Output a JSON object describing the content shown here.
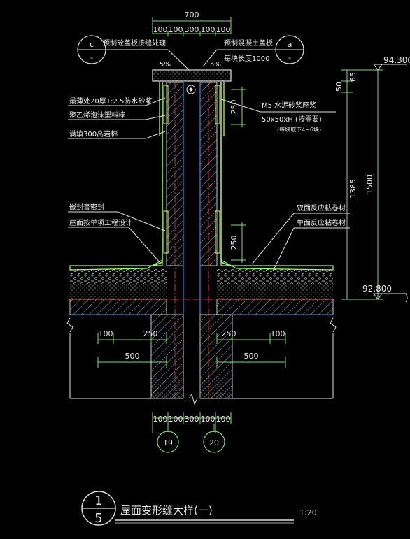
{
  "top_dims": {
    "overall": "700",
    "sub": [
      "100",
      "100",
      "300",
      "100",
      "100"
    ]
  },
  "bottom_dims": {
    "sub": [
      "100",
      "100",
      "300",
      "100",
      "100"
    ]
  },
  "grid_axes": {
    "left": "19",
    "right": "20"
  },
  "callout_left": {
    "letter": "c",
    "dash": "-"
  },
  "callout_right": {
    "letter": "a",
    "dash": "-"
  },
  "top_notes": {
    "left": "预制砼盖板接缝处理",
    "right_1": "预制混凝土盖板",
    "right_2": "每块长度1000"
  },
  "slopes": {
    "left": "5%",
    "right": "5%"
  },
  "left_labels": [
    "最薄处20厚1:2.5防水砂浆",
    "聚乙烯泡沫塑料棒",
    "满填300高岩棉",
    "嵌封膏密封",
    "屋面按单项工程设计"
  ],
  "right_labels": {
    "mortar": "M5 水泥砂浆座浆",
    "block": "50x50xH (按需要)",
    "block_note": "(每块取下4~6块)",
    "mem_double": "双面反应粘卷材",
    "mem_single": "单面反应粘卷材"
  },
  "vertical_dims": {
    "d250_top": "250",
    "d250_bottom": "250",
    "d50": "50",
    "d65": "65",
    "d1385": "1385",
    "d1500": "1500"
  },
  "elevations": {
    "top": "94.300",
    "bottom": "92.800"
  },
  "horizontal_dims": {
    "left_100": "100",
    "left_250": "250",
    "left_500": "500",
    "right_250": "250",
    "right_100": "100",
    "right_500": "500"
  },
  "title_block": {
    "number_top": "1",
    "number_bottom": "5",
    "title": "屋面变形缝大样(一)",
    "scale": "1:20"
  }
}
